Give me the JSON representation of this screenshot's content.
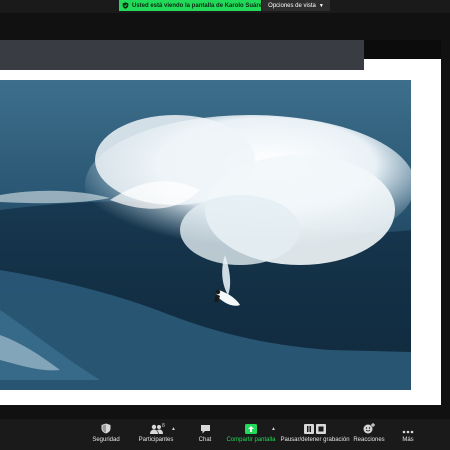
{
  "share_banner": {
    "text": "Usted está viendo la pantalla de Karolo Suárez",
    "color": "#23d959"
  },
  "view_options": {
    "label": "Opciones de vista",
    "icon": "chevron-down-icon"
  },
  "toolbar": {
    "security": {
      "label": "Seguridad",
      "icon": "shield-icon"
    },
    "participants": {
      "label": "Participantes",
      "count": "8",
      "icon": "people-icon"
    },
    "chat": {
      "label": "Chat",
      "icon": "chat-bubble-icon"
    },
    "share_screen": {
      "label": "Compartir pantalla",
      "icon": "share-arrow-icon",
      "color": "#23d959"
    },
    "recording": {
      "label": "Pausar/detener grabación",
      "icon": "pause-stop-icon"
    },
    "reactions": {
      "label": "Reacciones",
      "icon": "smiley-plus-icon"
    },
    "more": {
      "label": "Más",
      "icon": "ellipsis-icon"
    }
  }
}
